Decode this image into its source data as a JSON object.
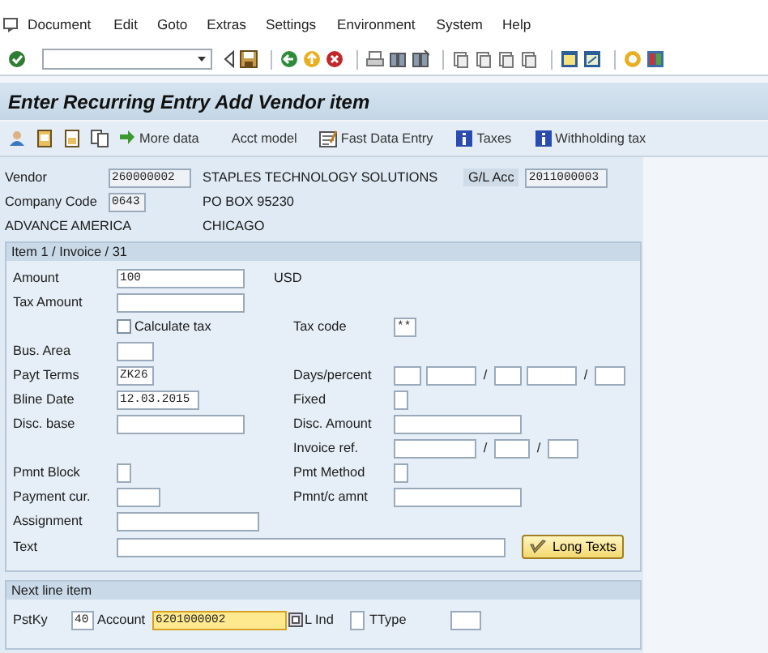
{
  "menu": [
    {
      "label": "Document"
    },
    {
      "label": "Edit"
    },
    {
      "label": "Goto"
    },
    {
      "label": "Extras"
    },
    {
      "label": "Settings"
    },
    {
      "label": "Environment"
    },
    {
      "label": "System"
    },
    {
      "label": "Help"
    }
  ],
  "title": "Enter Recurring Entry Add Vendor item",
  "app_toolbar": [
    {
      "label": "More data"
    },
    {
      "label": "Acct model"
    },
    {
      "label": "Fast Data Entry"
    },
    {
      "label": "Taxes"
    },
    {
      "label": "Withholding tax"
    }
  ],
  "header": {
    "vendor": {
      "label": "Vendor",
      "value": "260000002"
    },
    "vendor_name": "STAPLES TECHNOLOGY SOLUTIONS",
    "gl_account": {
      "label": "G/L Acc",
      "value": "2011000003"
    },
    "company_code": {
      "label": "Company Code",
      "value": "0643"
    },
    "address": "PO BOX 95230",
    "company_name": "ADVANCE AMERICA",
    "city": "CHICAGO"
  },
  "item": {
    "title": "Item 1 / Invoice / 31",
    "amount": {
      "label": "Amount",
      "value": "100",
      "currency": "USD"
    },
    "tax_amount": {
      "label": "Tax Amount"
    },
    "calculate_tax": {
      "label": "Calculate tax",
      "checked": false
    },
    "tax_code": {
      "label": "Tax code",
      "value": "**"
    },
    "business_area": {
      "label": "Bus. Area"
    },
    "payment_terms": {
      "label": "Payt Terms",
      "value": "ZK26"
    },
    "days_percent": {
      "label": "Days/percent",
      "separators": [
        "/",
        "/"
      ]
    },
    "baseline_date": {
      "label": "Bline Date",
      "value": "12.03.2015"
    },
    "fixed": {
      "label": "Fixed"
    },
    "discount_base": {
      "label": "Disc. base"
    },
    "discount_amount": {
      "label": "Disc. Amount"
    },
    "invoice_ref": {
      "label": "Invoice ref.",
      "separators": [
        "/",
        "/"
      ]
    },
    "payment_block": {
      "label": "Pmnt Block"
    },
    "payment_method": {
      "label": "Pmt Method"
    },
    "payment_currency": {
      "label": "Payment cur."
    },
    "payment_currency_amount": {
      "label": "Pmnt/c amnt"
    },
    "assignment": {
      "label": "Assignment"
    },
    "text": {
      "label": "Text"
    },
    "long_texts_button": {
      "label": "Long Texts"
    }
  },
  "next_line_item": {
    "title": "Next line item",
    "posting_key": {
      "label": "PstKy",
      "value": "40"
    },
    "account": {
      "label": "Account",
      "value": "6201000002",
      "focused": true
    },
    "l_ind": {
      "label": "L Ind"
    },
    "ttype": {
      "label": "TType"
    }
  }
}
